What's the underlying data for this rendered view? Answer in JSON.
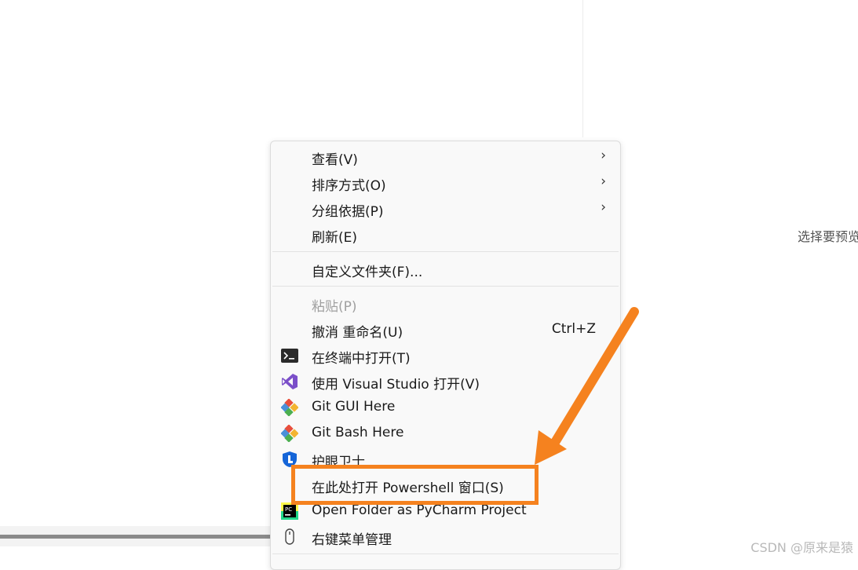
{
  "background": {
    "preview_text": "选择要预览",
    "watermark": "CSDN @原来是猿"
  },
  "menu": {
    "items": [
      {
        "label": "查看(V)",
        "submenu": true
      },
      {
        "label": "排序方式(O)",
        "submenu": true
      },
      {
        "label": "分组依据(P)",
        "submenu": true
      },
      {
        "label": "刷新(E)"
      },
      {
        "label": "自定义文件夹(F)..."
      },
      {
        "label": "粘贴(P)",
        "disabled": true
      },
      {
        "label": "撤消 重命名(U)",
        "shortcut": "Ctrl+Z"
      },
      {
        "label": "在终端中打开(T)",
        "icon": "terminal-icon"
      },
      {
        "label": "使用 Visual Studio 打开(V)",
        "icon": "visual-studio-icon"
      },
      {
        "label": "Git GUI Here",
        "icon": "git-icon"
      },
      {
        "label": "Git Bash Here",
        "icon": "git-icon"
      },
      {
        "label": "护眼卫士",
        "icon": "eye-guard-icon"
      },
      {
        "label": "在此处打开 Powershell 窗口(S)"
      },
      {
        "label": "Open Folder as PyCharm Project",
        "icon": "pycharm-icon"
      },
      {
        "label": "右键菜单管理",
        "icon": "mouse-icon"
      }
    ],
    "chevron": "›"
  },
  "annotation": {
    "color": "#f5821f",
    "highlighted_item": "在此处打开 Powershell 窗口(S)"
  }
}
